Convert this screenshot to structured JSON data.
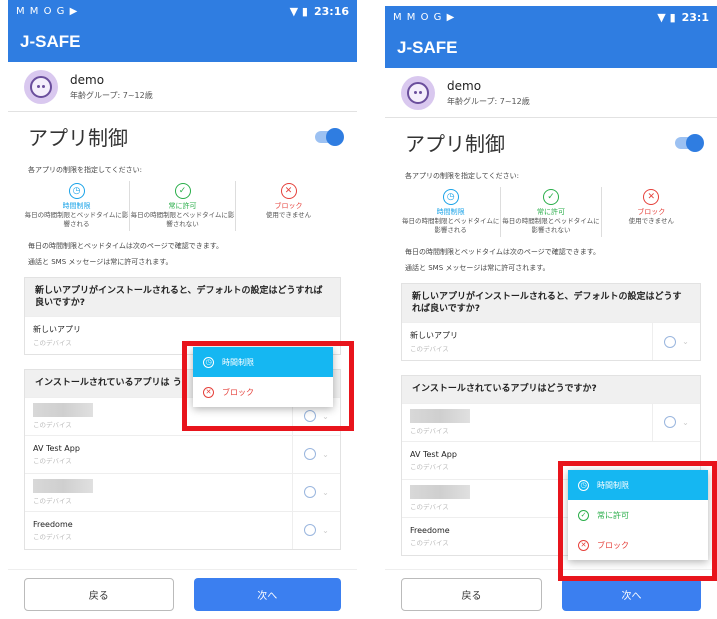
{
  "status_bar": {
    "icons_left": "M M O G ▶",
    "time_left": "23:16",
    "time_right": "23:1"
  },
  "app": {
    "title": "J-SAFE"
  },
  "profile": {
    "name": "demo",
    "group": "年齢グループ: 7~12歳"
  },
  "section": {
    "title": "アプリ制御",
    "instruction": "各アプリの制限を指定してください:"
  },
  "legend": [
    {
      "title": "時間制限",
      "desc": "毎日の時間制限とベッドタイムに影響される",
      "color": "#1aa3e8",
      "icon": "clock-icon"
    },
    {
      "title": "常に許可",
      "desc": "毎日の時間制限とベッドタイムに影響されない",
      "color": "#2aae4a",
      "icon": "check-icon"
    },
    {
      "title": "ブロック",
      "desc": "使用できません",
      "color": "#e5413b",
      "icon": "x-icon"
    }
  ],
  "notes": [
    "毎日の時間制限とベッドタイムは次のページで確認できます。",
    "通話と SMS メッセージは常に許可されます。"
  ],
  "new_app_card": {
    "heading": "新しいアプリがインストールされると、デフォルトの設定はどうすれば良いですか?",
    "row_name": "新しいアプリ",
    "row_sub": "このデバイス"
  },
  "installed_card": {
    "heading_left": "インストールされているアプリは",
    "heading_left_trail": "う",
    "heading_right": "インストールされているアプリはどうですか?",
    "rows": [
      {
        "name": "",
        "sub": "このデバイス",
        "blurred": true
      },
      {
        "name": "AV Test App",
        "sub": "このデバイス",
        "blurred": false
      },
      {
        "name": "",
        "sub": "このデバイス",
        "blurred": true
      },
      {
        "name": "Freedome",
        "sub": "このデバイス",
        "blurred": false
      }
    ]
  },
  "footer": {
    "back_label": "戻る",
    "next_label": "次へ"
  },
  "dropdown_left": [
    {
      "label": "時間制限",
      "selected": true
    },
    {
      "label": "ブロック",
      "selected": false
    }
  ],
  "dropdown_right": [
    {
      "label": "時間制限",
      "selected": true
    },
    {
      "label": "常に許可",
      "selected": false
    },
    {
      "label": "ブロック",
      "selected": false
    }
  ],
  "colors": {
    "primary": "#2f7de1",
    "highlight": "#e8141c",
    "selected_option": "#15b7f2"
  }
}
